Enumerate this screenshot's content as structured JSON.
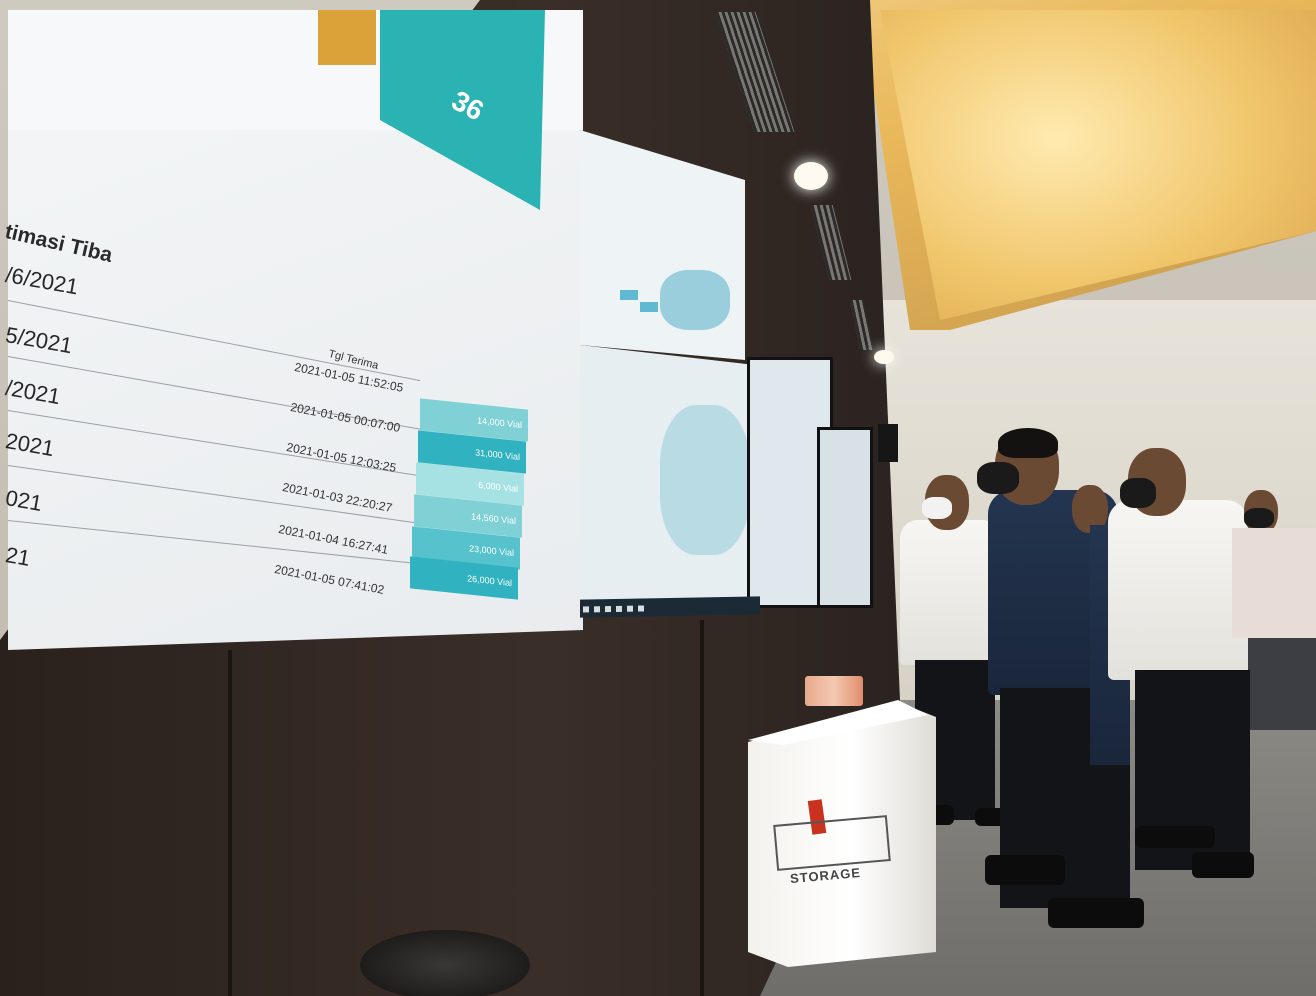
{
  "scene": {
    "description_type": "photo",
    "video_wall": {
      "kpi": {
        "number": "36"
      },
      "table": {
        "col_header_eta": "timasi Tiba",
        "eta_dates": [
          "/6/2021",
          "5/2021",
          "/2021",
          "2021",
          "021",
          "21"
        ],
        "col_header_received": "Tgl Terima",
        "received_dates": [
          "2021-01-05 11:52:05",
          "2021-01-05 00:07:00",
          "2021-01-05 12:03:25",
          "2021-01-03 22:20:27",
          "2021-01-04 16:27:41",
          "2021-01-05 07:41:02"
        ],
        "quantities": [
          "14,000 Vial",
          "31,000 Vial",
          "6,000 Vial",
          "14,560 Vial",
          "23,000 Vial",
          "26,000 Vial"
        ]
      }
    },
    "box": {
      "label": "STORAGE"
    },
    "colors": {
      "teal": "#2bb3b3",
      "orange": "#dca23a",
      "dark_wall": "#2a211d",
      "ceiling_glow": "#f0c56a"
    }
  }
}
